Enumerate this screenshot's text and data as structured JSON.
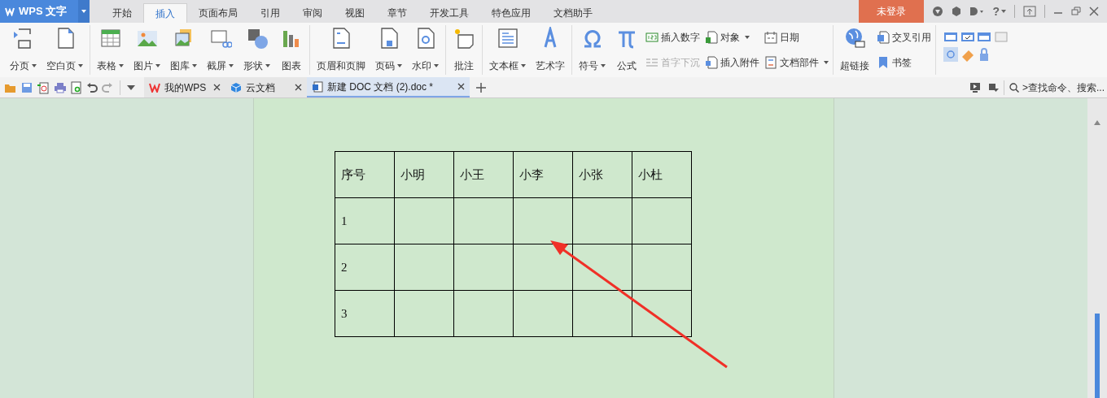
{
  "app": {
    "logo": "WPS 文字"
  },
  "menu_tabs": [
    {
      "label": "开始",
      "selected": false
    },
    {
      "label": "插入",
      "selected": true
    },
    {
      "label": "页面布局",
      "selected": false
    },
    {
      "label": "引用",
      "selected": false
    },
    {
      "label": "审阅",
      "selected": false
    },
    {
      "label": "视图",
      "selected": false
    },
    {
      "label": "章节",
      "selected": false
    },
    {
      "label": "开发工具",
      "selected": false
    },
    {
      "label": "特色应用",
      "selected": false
    },
    {
      "label": "文档助手",
      "selected": false
    }
  ],
  "login_button": "未登录",
  "help_button": "?",
  "ribbon": [
    {
      "items": [
        {
          "kind": "large",
          "label": "分页",
          "dropdown": true
        },
        {
          "kind": "large",
          "label": "空白页",
          "dropdown": true
        }
      ]
    },
    {
      "items": [
        {
          "kind": "large",
          "label": "表格",
          "dropdown": true
        },
        {
          "kind": "large",
          "label": "图片",
          "dropdown": true
        },
        {
          "kind": "large",
          "label": "图库",
          "dropdown": true
        },
        {
          "kind": "large",
          "label": "截屏",
          "dropdown": true
        },
        {
          "kind": "large",
          "label": "形状",
          "dropdown": true
        },
        {
          "kind": "large",
          "label": "图表",
          "dropdown": false
        }
      ]
    },
    {
      "items": [
        {
          "kind": "large",
          "label": "页眉和页脚",
          "dropdown": false
        },
        {
          "kind": "large",
          "label": "页码",
          "dropdown": true
        },
        {
          "kind": "large",
          "label": "水印",
          "dropdown": true
        }
      ]
    },
    {
      "items": [
        {
          "kind": "large",
          "label": "批注",
          "dropdown": false
        }
      ]
    },
    {
      "items": [
        {
          "kind": "large",
          "label": "文本框",
          "dropdown": true
        },
        {
          "kind": "large",
          "label": "艺术字",
          "dropdown": false
        }
      ]
    },
    {
      "items": [
        {
          "kind": "large",
          "label": "符号",
          "dropdown": true
        },
        {
          "kind": "large",
          "label": "公式",
          "dropdown": false
        },
        {
          "kind": "stack",
          "children": [
            {
              "label": "插入数字",
              "dropdown": false,
              "disabled": false
            },
            {
              "label": "首字下沉",
              "dropdown": false,
              "disabled": true
            }
          ]
        },
        {
          "kind": "stack",
          "children": [
            {
              "label": "对象",
              "dropdown": true,
              "disabled": false
            },
            {
              "label": "插入附件",
              "dropdown": false,
              "disabled": false
            }
          ]
        },
        {
          "kind": "stack",
          "children": [
            {
              "label": "日期",
              "dropdown": false,
              "disabled": false
            },
            {
              "label": "文档部件",
              "dropdown": true,
              "disabled": false
            }
          ]
        }
      ]
    },
    {
      "items": [
        {
          "kind": "large",
          "label": "超链接",
          "dropdown": false
        },
        {
          "kind": "stack",
          "children": [
            {
              "label": "交叉引用",
              "dropdown": false,
              "disabled": false
            },
            {
              "label": "书签",
              "dropdown": false,
              "disabled": false
            }
          ]
        }
      ]
    },
    {
      "items": [
        {
          "kind": "icons"
        }
      ]
    }
  ],
  "doc_tabs": [
    {
      "label": "我的WPS",
      "selected": false
    },
    {
      "label": "云文档",
      "selected": false
    },
    {
      "label": "新建 DOC 文档 (2).doc *",
      "selected": true
    }
  ],
  "search": {
    "placeholder": ">查找命令、搜索..."
  },
  "table": {
    "rows": [
      [
        "序号",
        "小明",
        "小王",
        "小李",
        "小张",
        "小杜"
      ],
      [
        "1",
        "",
        "",
        "",
        "",
        ""
      ],
      [
        "2",
        "",
        "",
        "",
        "",
        ""
      ],
      [
        "3",
        "",
        "",
        "",
        "",
        ""
      ]
    ]
  }
}
